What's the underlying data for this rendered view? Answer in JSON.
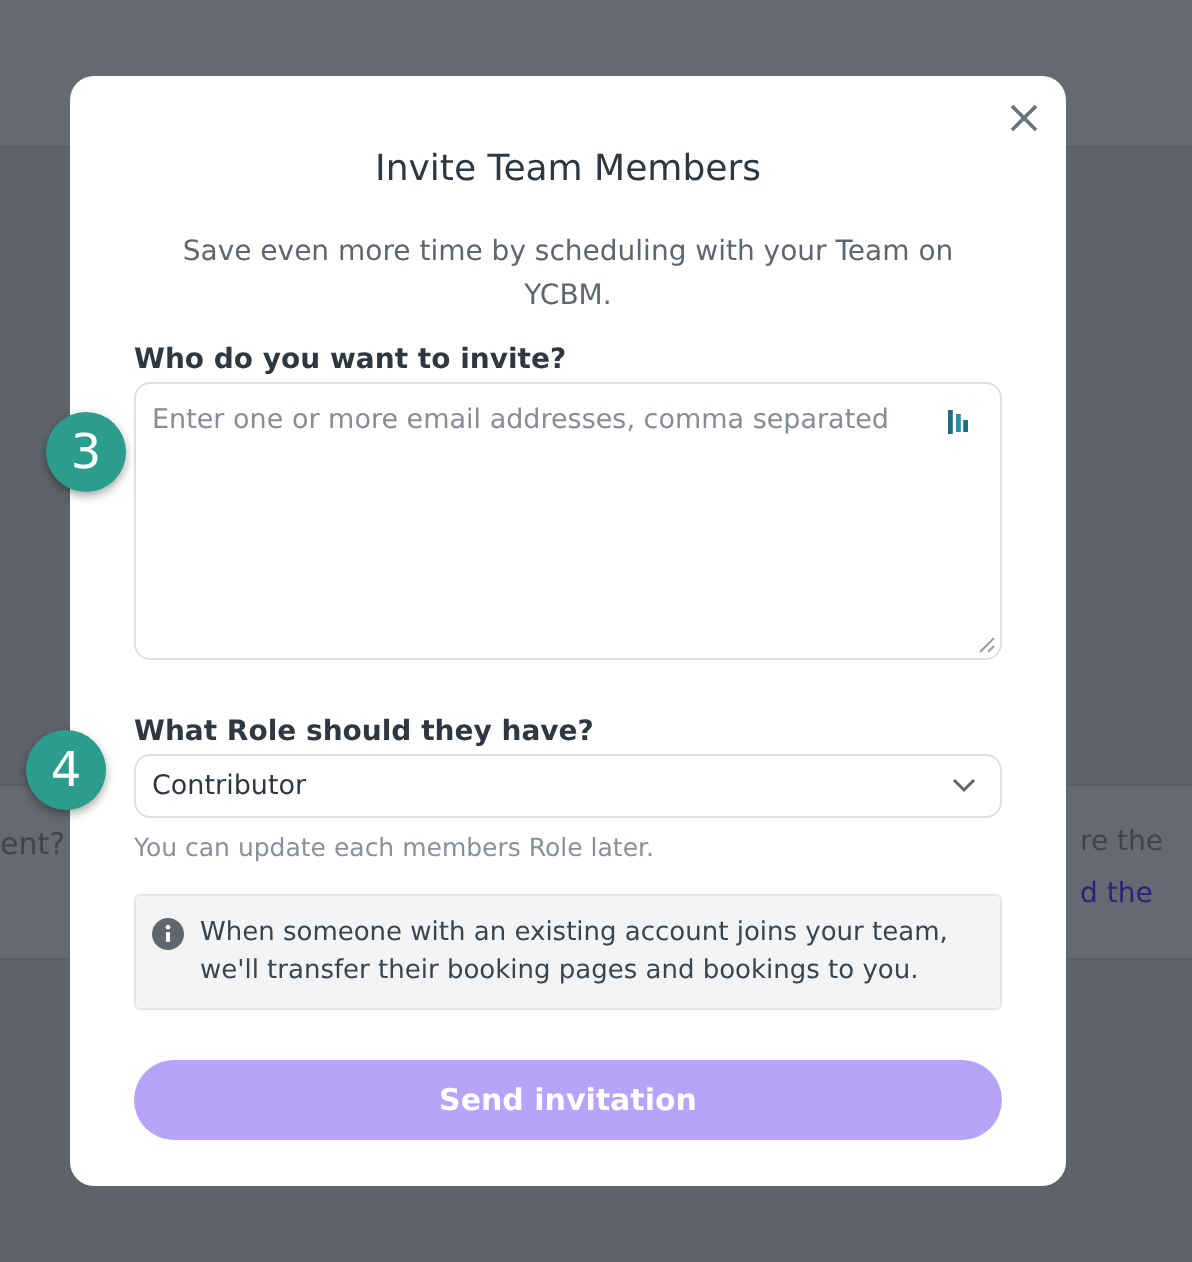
{
  "background": {
    "left_text": "ent?",
    "right_text": "re the",
    "right_link": "d the"
  },
  "markers": [
    {
      "label": "3"
    },
    {
      "label": "4"
    }
  ],
  "dialog": {
    "title": "Invite Team Members",
    "subtitle": "Save even more time by scheduling with your Team on YCBM.",
    "invite_label": "Who do you want to invite?",
    "invite_placeholder": "Enter one or more email addresses, comma separated",
    "role_label": "What Role should they have?",
    "role_value": "Contributor",
    "role_hint": "You can update each members Role later.",
    "info": "When someone with an existing account joins your team, we'll transfer their booking pages and bookings to you.",
    "send_button": "Send invitation"
  }
}
